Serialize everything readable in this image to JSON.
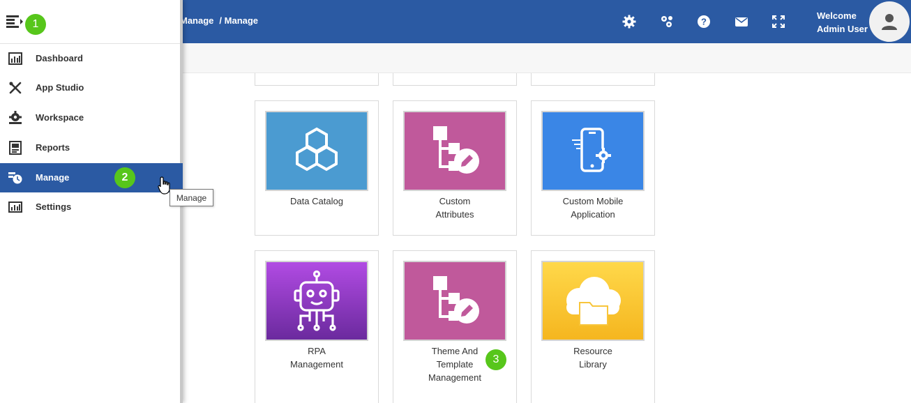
{
  "header": {
    "breadcrumb": [
      "Manage",
      "/ Manage"
    ],
    "welcome_line1": "Welcome",
    "welcome_line2": "Admin User",
    "icons": [
      "settings-icon",
      "workflow-icon",
      "help-icon",
      "mail-icon",
      "fullscreen-icon",
      "user-avatar-icon"
    ],
    "brand_color": "#2b5aa3"
  },
  "sidebar": {
    "toggle_icon": "menu-collapse-icon",
    "items": [
      {
        "label": "Dashboard",
        "icon": "dashboard-icon"
      },
      {
        "label": "App Studio",
        "icon": "tools-icon"
      },
      {
        "label": "Workspace",
        "icon": "workspace-icon"
      },
      {
        "label": "Reports",
        "icon": "reports-icon"
      },
      {
        "label": "Manage",
        "icon": "manage-icon",
        "active": true
      },
      {
        "label": "Settings",
        "icon": "settings-icon"
      }
    ],
    "tooltip": "Manage"
  },
  "tiles": [
    {
      "line1": "Data Catalog",
      "line2": "",
      "line3": "",
      "color": "#4b9bd1",
      "icon": "hexagons-icon"
    },
    {
      "line1": "Custom",
      "line2": "Attributes",
      "line3": "",
      "color": "#c0599b",
      "icon": "tree-edit-icon"
    },
    {
      "line1": "Custom Mobile",
      "line2": "Application",
      "line3": "",
      "color": "#3a86e6",
      "icon": "mobile-gear-icon"
    },
    {
      "line1": "RPA",
      "line2": "Management",
      "line3": "",
      "color": "#9138c9",
      "icon": "robot-icon"
    },
    {
      "line1": "Theme And",
      "line2": "Template",
      "line3": "Management",
      "color": "#c0599b",
      "icon": "tree-edit-icon"
    },
    {
      "line1": "Resource",
      "line2": "Library",
      "line3": "",
      "color": "#fbc52f",
      "icon": "cloud-folder-icon"
    }
  ],
  "badges": [
    "1",
    "2",
    "3"
  ]
}
